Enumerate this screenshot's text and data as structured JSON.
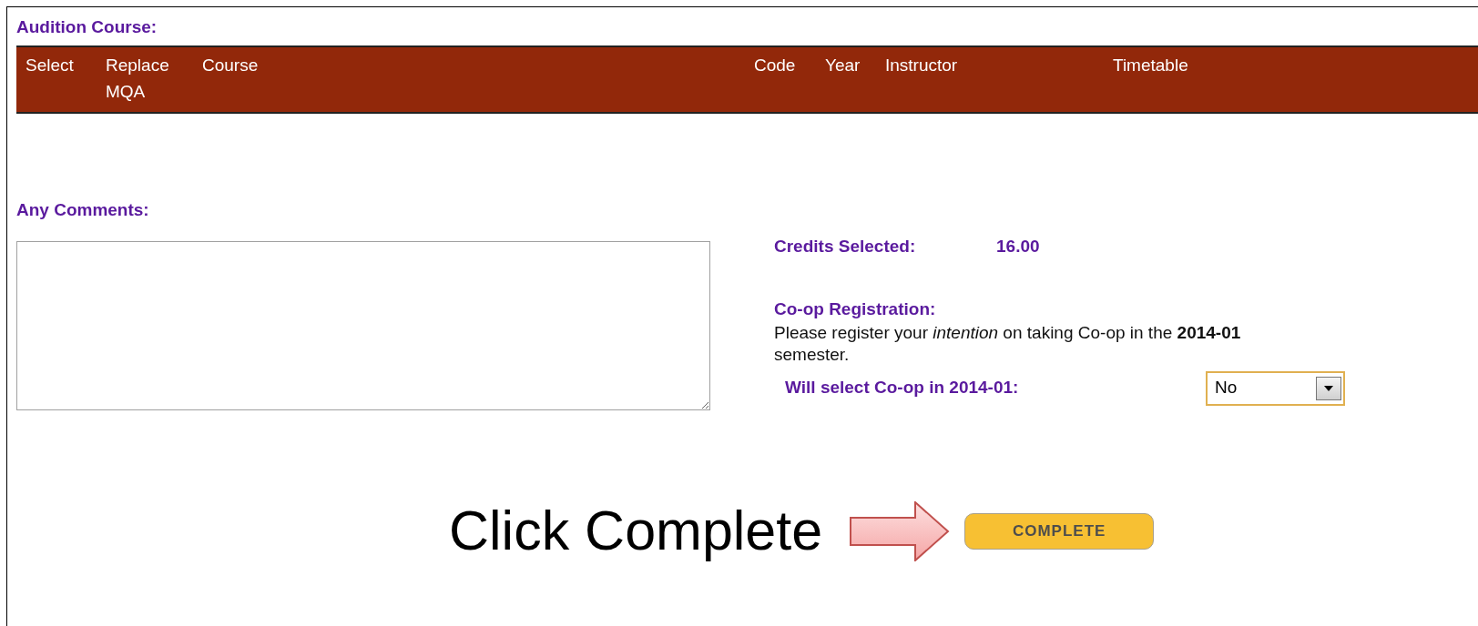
{
  "section_title": "Audition Course:",
  "table": {
    "columns": [
      {
        "label": "Select"
      },
      {
        "label": "Replace MQA"
      },
      {
        "label": "Course"
      },
      {
        "label": "Code"
      },
      {
        "label": "Year"
      },
      {
        "label": "Instructor"
      },
      {
        "label": "Timetable"
      }
    ]
  },
  "comments": {
    "label": "Any Comments:"
  },
  "credits": {
    "label": "Credits Selected:",
    "value": "16.00"
  },
  "coop": {
    "title": "Co-op Registration:",
    "note": "Please register your *intention* on taking Co-op in the **2014-01** semester.",
    "select_label": "Will select Co-op in 2014-01:",
    "select_value": "No"
  },
  "annotation": {
    "text": "Click Complete"
  },
  "complete_button": {
    "label": "COMPLETE"
  }
}
